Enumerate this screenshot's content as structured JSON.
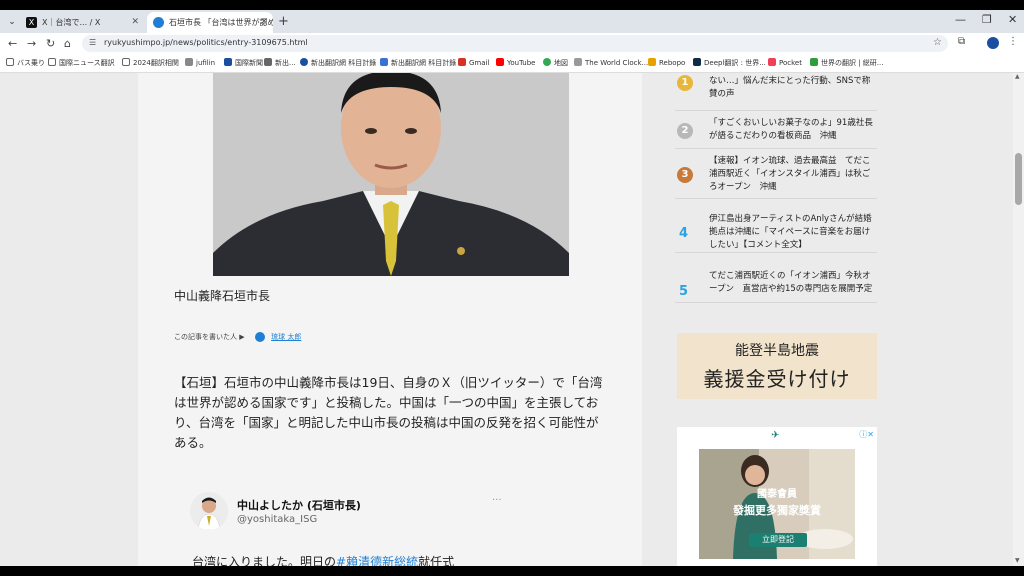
{
  "tabs": [
    {
      "title": "X｜台湾で... / X",
      "favicon": "X"
    },
    {
      "title": "石垣市長 「台湾は世界が認め...」",
      "favicon": "●"
    }
  ],
  "url": "ryukyushimpo.jp/news/politics/entry-3109675.html",
  "bookmarks": [
    "バス乗り",
    "国際ニュース翻訳",
    "2024翻訳相関",
    "jufilin",
    "国際新聞",
    "新出...",
    "新出翻訳網 科目計錄",
    "新出翻訳網 科目計錄",
    "Gmail",
    "YouTube",
    "地図",
    "The World Clock...",
    "Rebopo",
    "Deepl翻訳 : 世界...",
    "Pocket",
    "世界の翻訳 | 総研..."
  ],
  "article": {
    "caption": "中山義降石垣市長",
    "byline_prefix": "この記事を書いた人",
    "byline_author": "琉球 太郎",
    "body": "【石垣】石垣市の中山義降市長は19日、自身のＸ（旧ツイッター）で「台湾は世界が認める国家です」と投稿した。中国は「一つの中国」を主張しており、台湾を「国家」と明記した中山市長の投稿は中国の反発を招く可能性がある。",
    "tweet": {
      "name": "中山よしたか (石垣市長)",
      "handle": "@yoshitaka_ISG",
      "text_before": "台湾に入りました。明日の",
      "hashtag": "#賴清德新総統",
      "text_after": "就任式"
    }
  },
  "ranking": [
    {
      "rank": "1",
      "text": "ない…」悩んだ末にとった行動、SNSで称賛の声"
    },
    {
      "rank": "2",
      "text": "「すごくおいしいお菓子なのよ」91歳社長が語るこだわりの看板商品　沖縄"
    },
    {
      "rank": "3",
      "text": "【速報】イオン琉球、過去最高益　てだこ浦西駅近く「イオンスタイル浦西」は秋ごろオープン　沖縄"
    },
    {
      "rank": "4",
      "text": "伊江島出身アーティストのAnlyさんが結婚　拠点は沖縄に「マイペースに音楽をお届けしたい」【コメント全文】"
    },
    {
      "rank": "5",
      "text": "てだこ浦西駅近くの「イオン浦西」今秋オープン　直営店や約15の専門店を展開予定"
    }
  ],
  "banner": {
    "line1": "能登半島地震",
    "line2": "義援金受け付け"
  },
  "ad": {
    "line1": "國泰會員",
    "line2": "發掘更多獨家獎賞",
    "button": "立即登記"
  },
  "colors": {
    "accent": "#2aa3e0",
    "link": "#1f7fd4",
    "ad_green": "#1b7f71"
  }
}
